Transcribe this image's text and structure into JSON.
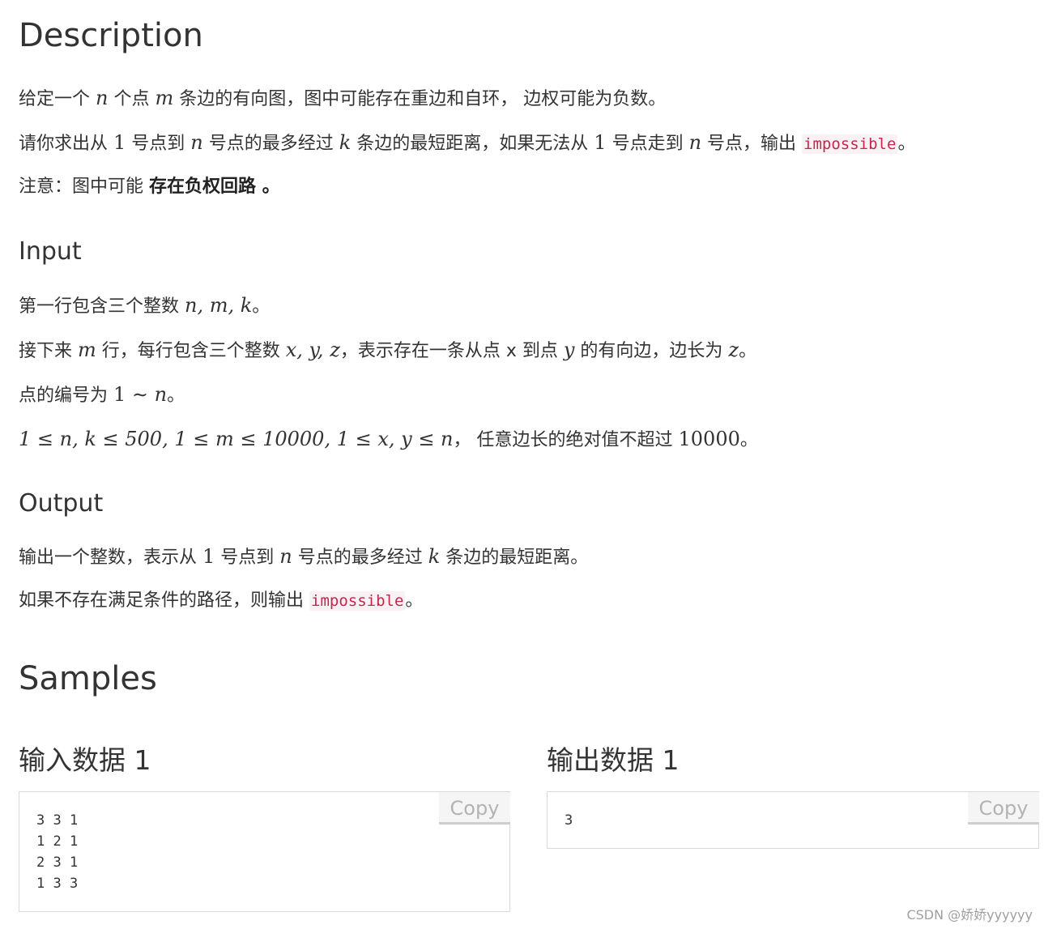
{
  "description": {
    "heading": "Description",
    "p1": {
      "t1": "给定一个 ",
      "n": "n",
      "t2": " 个点 ",
      "m": "m",
      "t3": " 条边的有向图，图中可能存在重边和自环， 边权可能为负数。"
    },
    "p2": {
      "t1": "请你求出从 ",
      "one_a": "1",
      "t2": " 号点到 ",
      "n_a": "n",
      "t3": " 号点的最多经过 ",
      "k": "k",
      "t4": " 条边的最短距离，如果无法从 ",
      "one_b": "1",
      "t5": " 号点走到 ",
      "n_b": "n",
      "t6": " 号点，输出 ",
      "code": "impossible",
      "t7": "。"
    },
    "p3": {
      "t1": "注意：图中可能 ",
      "bold": "存在负权回路 。"
    }
  },
  "input": {
    "heading": "Input",
    "p1": {
      "t1": "第一行包含三个整数 ",
      "math": "n, m, k",
      "t2": "。"
    },
    "p2": {
      "t1": "接下来 ",
      "m": "m",
      "t2": " 行，每行包含三个整数 ",
      "xyz": "x, y, z",
      "t3": "，表示存在一条从点 x 到点 ",
      "y": "y",
      "t4": " 的有向边，边长为 ",
      "z": "z",
      "t5": "。"
    },
    "p3": {
      "t1": "点的编号为 ",
      "range": "1 ∼ ",
      "n": "n",
      "t2": "。"
    },
    "p4": {
      "math": "1 ≤ n, k ≤ 500, 1 ≤ m ≤ 10000, 1 ≤ x, y ≤ n",
      "t1": "，  任意边长的绝对值不超过 ",
      "num": "10000",
      "t2": "。"
    }
  },
  "output": {
    "heading": "Output",
    "p1": {
      "t1": "输出一个整数，表示从 ",
      "one": "1",
      "t2": " 号点到 ",
      "n": "n",
      "t3": " 号点的最多经过 ",
      "k": "k",
      "t4": " 条边的最短距离。"
    },
    "p2": {
      "t1": "如果不存在满足条件的路径，则输出 ",
      "code": "impossible",
      "t2": "。"
    }
  },
  "samples": {
    "heading": "Samples",
    "input": {
      "title": "输入数据 1",
      "content": "3 3 1\n1 2 1\n2 3 1\n1 3 3",
      "copy_label": "Copy"
    },
    "output": {
      "title": "输出数据 1",
      "content": "3",
      "copy_label": "Copy"
    }
  },
  "watermark": "CSDN @娇娇yyyyyy"
}
